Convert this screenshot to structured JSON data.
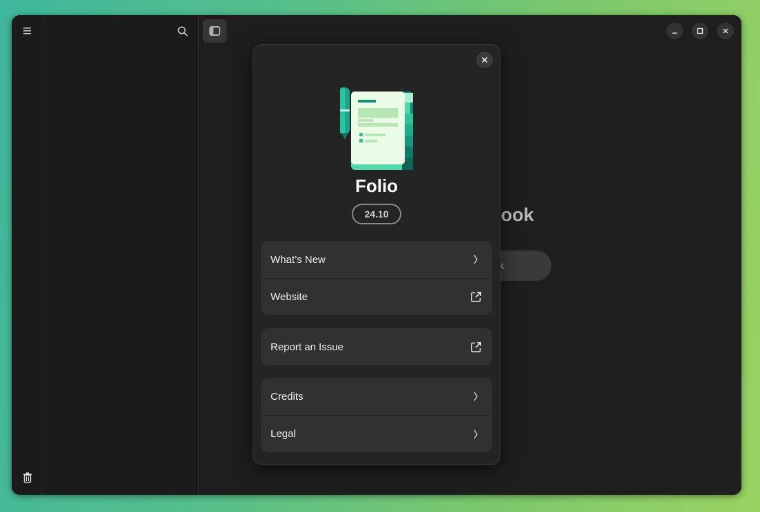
{
  "background_app": {
    "heading_fragment": "ebook",
    "button_fragment": "k"
  },
  "about_dialog": {
    "app_name": "Folio",
    "version": "24.10",
    "groups": [
      {
        "rows": [
          {
            "label": "What’s New",
            "icon": "chevron-right-icon"
          },
          {
            "label": "Website",
            "icon": "external-link-icon"
          }
        ]
      },
      {
        "rows": [
          {
            "label": "Report an Issue",
            "icon": "external-link-icon"
          }
        ]
      },
      {
        "rows": [
          {
            "label": "Credits",
            "icon": "chevron-right-icon"
          },
          {
            "label": "Legal",
            "icon": "chevron-right-icon"
          }
        ]
      }
    ]
  },
  "colors": {
    "window_bg": "#1e1e1e",
    "dialog_bg": "#242424",
    "row_bg": "#313131",
    "accent_teal": "#2ec4a6"
  }
}
